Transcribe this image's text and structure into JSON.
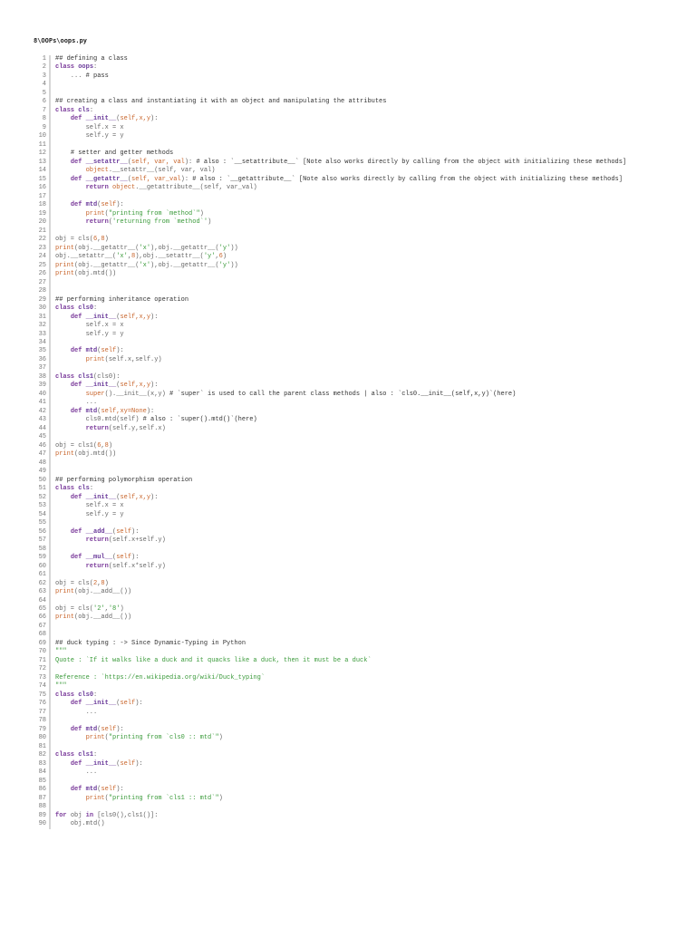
{
  "file_title": "8\\OOPs\\oops.py",
  "first_line": 1,
  "colors": {
    "keyword": "#7a3a9a",
    "param": "#c8642a",
    "string": "#3a9a3a",
    "comment": "#333333",
    "plain": "#666666"
  },
  "lines": [
    [
      [
        "c",
        "## defining a class"
      ]
    ],
    [
      [
        "k",
        "class "
      ],
      [
        "f",
        "oops"
      ],
      [
        "t",
        ":"
      ]
    ],
    [
      [
        "t",
        "    ... "
      ],
      [
        "c",
        "# pass"
      ]
    ],
    [],
    [],
    [
      [
        "c",
        "## creating a class and instantiating it with an object and manipulating the attributes"
      ]
    ],
    [
      [
        "k",
        "class "
      ],
      [
        "f",
        "cls"
      ],
      [
        "t",
        ":"
      ]
    ],
    [
      [
        "t",
        "    "
      ],
      [
        "k",
        "def "
      ],
      [
        "f",
        "__init__"
      ],
      [
        "t",
        "("
      ],
      [
        "p",
        "self,x,y"
      ],
      [
        "t",
        "):"
      ]
    ],
    [
      [
        "t",
        "        self.x = x"
      ]
    ],
    [
      [
        "t",
        "        self.y = y"
      ]
    ],
    [],
    [
      [
        "t",
        "    "
      ],
      [
        "c",
        "# setter and getter methods"
      ]
    ],
    [
      [
        "t",
        "    "
      ],
      [
        "k",
        "def "
      ],
      [
        "f",
        "__setattr__"
      ],
      [
        "t",
        "("
      ],
      [
        "p",
        "self, var, val"
      ],
      [
        "t",
        "): "
      ],
      [
        "c",
        "# also : `__setattribute__` [Note also works directly by calling from the object with initializing these methods]"
      ]
    ],
    [
      [
        "t",
        "        "
      ],
      [
        "b",
        "object"
      ],
      [
        "t",
        ".__setattr__(self, var, val)"
      ]
    ],
    [
      [
        "t",
        "    "
      ],
      [
        "k",
        "def "
      ],
      [
        "f",
        "__getattr__"
      ],
      [
        "t",
        "("
      ],
      [
        "p",
        "self, var_val"
      ],
      [
        "t",
        "): "
      ],
      [
        "c",
        "# also : `__getattribute__` [Note also works directly by calling from the object with initializing these methods]"
      ]
    ],
    [
      [
        "t",
        "        "
      ],
      [
        "k",
        "return "
      ],
      [
        "b",
        "object"
      ],
      [
        "t",
        ".__getattribute__(self, var_val)"
      ]
    ],
    [],
    [
      [
        "t",
        "    "
      ],
      [
        "k",
        "def "
      ],
      [
        "f",
        "mtd"
      ],
      [
        "t",
        "("
      ],
      [
        "p",
        "self"
      ],
      [
        "t",
        "):"
      ]
    ],
    [
      [
        "t",
        "        "
      ],
      [
        "b",
        "print"
      ],
      [
        "t",
        "("
      ],
      [
        "s",
        "\"printing from `method`\""
      ],
      [
        "t",
        ")"
      ]
    ],
    [
      [
        "t",
        "        "
      ],
      [
        "k",
        "return"
      ],
      [
        "t",
        "("
      ],
      [
        "s",
        "'returning from `method`'"
      ],
      [
        "t",
        ")"
      ]
    ],
    [],
    [
      [
        "t",
        "obj = cls("
      ],
      [
        "b",
        "6"
      ],
      [
        "t",
        ","
      ],
      [
        "b",
        "8"
      ],
      [
        "t",
        ")"
      ]
    ],
    [
      [
        "b",
        "print"
      ],
      [
        "t",
        "(obj.__getattr__("
      ],
      [
        "s",
        "'x'"
      ],
      [
        "t",
        "),obj.__getattr__("
      ],
      [
        "s",
        "'y'"
      ],
      [
        "t",
        "))"
      ]
    ],
    [
      [
        "t",
        "obj.__setattr__("
      ],
      [
        "s",
        "'x'"
      ],
      [
        "t",
        ","
      ],
      [
        "b",
        "8"
      ],
      [
        "t",
        "),obj.__setattr__("
      ],
      [
        "s",
        "'y'"
      ],
      [
        "t",
        ","
      ],
      [
        "b",
        "6"
      ],
      [
        "t",
        ")"
      ]
    ],
    [
      [
        "b",
        "print"
      ],
      [
        "t",
        "(obj.__getattr__("
      ],
      [
        "s",
        "'x'"
      ],
      [
        "t",
        "),obj.__getattr__("
      ],
      [
        "s",
        "'y'"
      ],
      [
        "t",
        "))"
      ]
    ],
    [
      [
        "b",
        "print"
      ],
      [
        "t",
        "(obj.mtd())"
      ]
    ],
    [],
    [],
    [
      [
        "c",
        "## performing inheritance operation"
      ]
    ],
    [
      [
        "k",
        "class "
      ],
      [
        "f",
        "cls0"
      ],
      [
        "t",
        ":"
      ]
    ],
    [
      [
        "t",
        "    "
      ],
      [
        "k",
        "def "
      ],
      [
        "f",
        "__init__"
      ],
      [
        "t",
        "("
      ],
      [
        "p",
        "self,x,y"
      ],
      [
        "t",
        "):"
      ]
    ],
    [
      [
        "t",
        "        self.x = x"
      ]
    ],
    [
      [
        "t",
        "        self.y = y"
      ]
    ],
    [],
    [
      [
        "t",
        "    "
      ],
      [
        "k",
        "def "
      ],
      [
        "f",
        "mtd"
      ],
      [
        "t",
        "("
      ],
      [
        "p",
        "self"
      ],
      [
        "t",
        "):"
      ]
    ],
    [
      [
        "t",
        "        "
      ],
      [
        "b",
        "print"
      ],
      [
        "t",
        "(self.x,self.y)"
      ]
    ],
    [],
    [
      [
        "k",
        "class "
      ],
      [
        "f",
        "cls1"
      ],
      [
        "t",
        "(cls0):"
      ]
    ],
    [
      [
        "t",
        "    "
      ],
      [
        "k",
        "def "
      ],
      [
        "f",
        "__init__"
      ],
      [
        "t",
        "("
      ],
      [
        "p",
        "self,x,y"
      ],
      [
        "t",
        "):"
      ]
    ],
    [
      [
        "t",
        "        "
      ],
      [
        "b",
        "super"
      ],
      [
        "t",
        "().__init__(x,y) "
      ],
      [
        "c",
        "# `super` is used to call the parent class methods | also : `cls0.__init__(self,x,y)`(here)"
      ]
    ],
    [
      [
        "t",
        "        ..."
      ]
    ],
    [
      [
        "t",
        "    "
      ],
      [
        "k",
        "def "
      ],
      [
        "f",
        "mtd"
      ],
      [
        "t",
        "("
      ],
      [
        "p",
        "self,xy=None"
      ],
      [
        "t",
        "):"
      ]
    ],
    [
      [
        "t",
        "        cls0.mtd(self) "
      ],
      [
        "c",
        "# also : `super().mtd()`(here)"
      ]
    ],
    [
      [
        "t",
        "        "
      ],
      [
        "k",
        "return"
      ],
      [
        "t",
        "(self.y,self.x)"
      ]
    ],
    [],
    [
      [
        "t",
        "obj = cls1("
      ],
      [
        "b",
        "6"
      ],
      [
        "t",
        ","
      ],
      [
        "b",
        "8"
      ],
      [
        "t",
        ")"
      ]
    ],
    [
      [
        "b",
        "print"
      ],
      [
        "t",
        "(obj.mtd())"
      ]
    ],
    [],
    [],
    [
      [
        "c",
        "## performing polymorphism operation"
      ]
    ],
    [
      [
        "k",
        "class "
      ],
      [
        "f",
        "cls"
      ],
      [
        "t",
        ":"
      ]
    ],
    [
      [
        "t",
        "    "
      ],
      [
        "k",
        "def "
      ],
      [
        "f",
        "__init__"
      ],
      [
        "t",
        "("
      ],
      [
        "p",
        "self,x,y"
      ],
      [
        "t",
        "):"
      ]
    ],
    [
      [
        "t",
        "        self.x = x"
      ]
    ],
    [
      [
        "t",
        "        self.y = y"
      ]
    ],
    [],
    [
      [
        "t",
        "    "
      ],
      [
        "k",
        "def "
      ],
      [
        "f",
        "__add__"
      ],
      [
        "t",
        "("
      ],
      [
        "p",
        "self"
      ],
      [
        "t",
        "):"
      ]
    ],
    [
      [
        "t",
        "        "
      ],
      [
        "k",
        "return"
      ],
      [
        "t",
        "(self.x+self.y)"
      ]
    ],
    [],
    [
      [
        "t",
        "    "
      ],
      [
        "k",
        "def "
      ],
      [
        "f",
        "__mul__"
      ],
      [
        "t",
        "("
      ],
      [
        "p",
        "self"
      ],
      [
        "t",
        "):"
      ]
    ],
    [
      [
        "t",
        "        "
      ],
      [
        "k",
        "return"
      ],
      [
        "t",
        "(self.x*self.y)"
      ]
    ],
    [],
    [
      [
        "t",
        "obj = cls("
      ],
      [
        "b",
        "2"
      ],
      [
        "t",
        ","
      ],
      [
        "b",
        "8"
      ],
      [
        "t",
        ")"
      ]
    ],
    [
      [
        "b",
        "print"
      ],
      [
        "t",
        "(obj.__add__())"
      ]
    ],
    [],
    [
      [
        "t",
        "obj = cls("
      ],
      [
        "s",
        "'2'"
      ],
      [
        "t",
        ","
      ],
      [
        "s",
        "'8'"
      ],
      [
        "t",
        ")"
      ]
    ],
    [
      [
        "b",
        "print"
      ],
      [
        "t",
        "(obj.__add__())"
      ]
    ],
    [],
    [],
    [
      [
        "c",
        "## duck typing : -> Since Dynamic-Typing in Python"
      ]
    ],
    [
      [
        "s",
        "\"\"\""
      ]
    ],
    [
      [
        "s",
        "Quote : `If it walks like a duck and it quacks like a duck, then it must be a duck`"
      ]
    ],
    [],
    [
      [
        "s",
        "Reference : `https://en.wikipedia.org/wiki/Duck_typing`"
      ]
    ],
    [
      [
        "s",
        "\"\"\""
      ]
    ],
    [
      [
        "k",
        "class "
      ],
      [
        "f",
        "cls0"
      ],
      [
        "t",
        ":"
      ]
    ],
    [
      [
        "t",
        "    "
      ],
      [
        "k",
        "def "
      ],
      [
        "f",
        "__init__"
      ],
      [
        "t",
        "("
      ],
      [
        "p",
        "self"
      ],
      [
        "t",
        "):"
      ]
    ],
    [
      [
        "t",
        "        ..."
      ]
    ],
    [],
    [
      [
        "t",
        "    "
      ],
      [
        "k",
        "def "
      ],
      [
        "f",
        "mtd"
      ],
      [
        "t",
        "("
      ],
      [
        "p",
        "self"
      ],
      [
        "t",
        "):"
      ]
    ],
    [
      [
        "t",
        "        "
      ],
      [
        "b",
        "print"
      ],
      [
        "t",
        "("
      ],
      [
        "s",
        "\"printing from `cls0 :: mtd`\""
      ],
      [
        "t",
        ")"
      ]
    ],
    [],
    [
      [
        "k",
        "class "
      ],
      [
        "f",
        "cls1"
      ],
      [
        "t",
        ":"
      ]
    ],
    [
      [
        "t",
        "    "
      ],
      [
        "k",
        "def "
      ],
      [
        "f",
        "__init__"
      ],
      [
        "t",
        "("
      ],
      [
        "p",
        "self"
      ],
      [
        "t",
        "):"
      ]
    ],
    [
      [
        "t",
        "        ..."
      ]
    ],
    [],
    [
      [
        "t",
        "    "
      ],
      [
        "k",
        "def "
      ],
      [
        "f",
        "mtd"
      ],
      [
        "t",
        "("
      ],
      [
        "p",
        "self"
      ],
      [
        "t",
        "):"
      ]
    ],
    [
      [
        "t",
        "        "
      ],
      [
        "b",
        "print"
      ],
      [
        "t",
        "("
      ],
      [
        "s",
        "\"printing from `cls1 :: mtd`\""
      ],
      [
        "t",
        ")"
      ]
    ],
    [],
    [
      [
        "k",
        "for "
      ],
      [
        "t",
        "obj "
      ],
      [
        "k",
        "in "
      ],
      [
        "t",
        "[cls0(),cls1()]:"
      ]
    ],
    [
      [
        "t",
        "    obj.mtd()"
      ]
    ]
  ]
}
